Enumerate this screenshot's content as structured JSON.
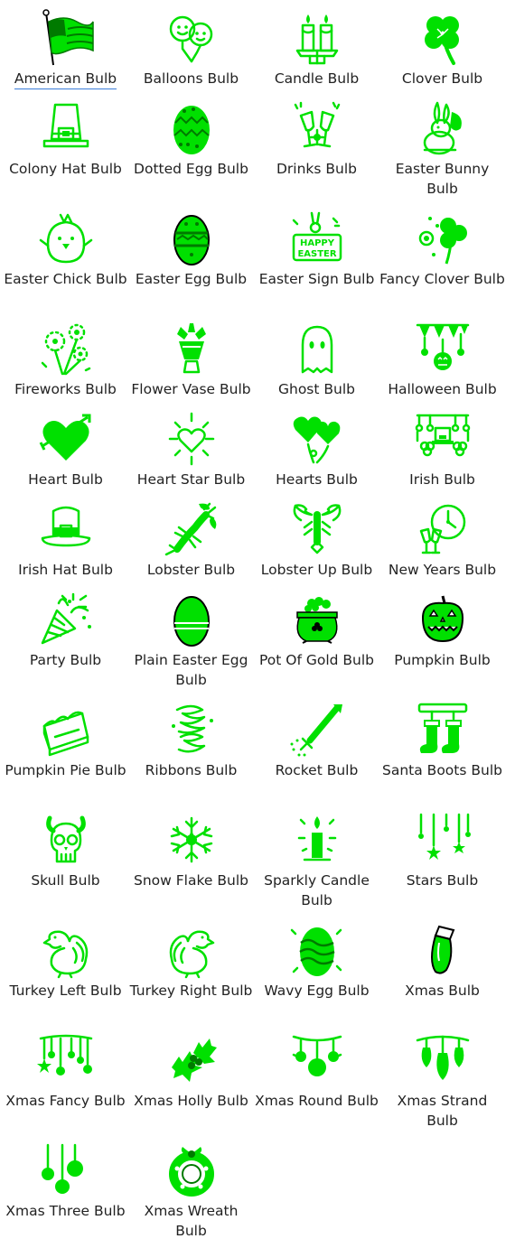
{
  "theme": {
    "icon_color": "#00e000",
    "icon_dark": "#007a00",
    "text_color": "#222222",
    "selected_underline": "#3b7dd8"
  },
  "selected_index": 0,
  "bulbs": [
    {
      "label": "American Bulb",
      "icon": "american-flag-icon"
    },
    {
      "label": "Balloons Bulb",
      "icon": "balloons-icon"
    },
    {
      "label": "Candle Bulb",
      "icon": "candle-icon"
    },
    {
      "label": "Clover Bulb",
      "icon": "clover-icon"
    },
    {
      "label": "Colony Hat Bulb",
      "icon": "colony-hat-icon"
    },
    {
      "label": "Dotted Egg Bulb",
      "icon": "dotted-egg-icon"
    },
    {
      "label": "Drinks Bulb",
      "icon": "drinks-icon"
    },
    {
      "label": "Easter Bunny Bulb",
      "icon": "easter-bunny-icon"
    },
    {
      "label": "Easter Chick Bulb",
      "icon": "easter-chick-icon"
    },
    {
      "label": "Easter Egg Bulb",
      "icon": "easter-egg-icon"
    },
    {
      "label": "Easter Sign Bulb",
      "icon": "easter-sign-icon",
      "sign_text": [
        "HAPPY",
        "EASTER"
      ]
    },
    {
      "label": "Fancy Clover Bulb",
      "icon": "fancy-clover-icon"
    },
    {
      "label": "Fireworks Bulb",
      "icon": "fireworks-icon"
    },
    {
      "label": "Flower Vase Bulb",
      "icon": "flower-vase-icon"
    },
    {
      "label": "Ghost Bulb",
      "icon": "ghost-icon"
    },
    {
      "label": "Halloween Bulb",
      "icon": "halloween-icon"
    },
    {
      "label": "Heart Bulb",
      "icon": "heart-arrow-icon"
    },
    {
      "label": "Heart Star Bulb",
      "icon": "heart-star-icon"
    },
    {
      "label": "Hearts Bulb",
      "icon": "hearts-icon"
    },
    {
      "label": "Irish Bulb",
      "icon": "irish-icon"
    },
    {
      "label": "Irish Hat Bulb",
      "icon": "irish-hat-icon"
    },
    {
      "label": "Lobster Bulb",
      "icon": "lobster-icon"
    },
    {
      "label": "Lobster Up Bulb",
      "icon": "lobster-up-icon"
    },
    {
      "label": "New Years Bulb",
      "icon": "new-years-icon"
    },
    {
      "label": "Party Bulb",
      "icon": "party-icon"
    },
    {
      "label": "Plain Easter Egg Bulb",
      "icon": "plain-easter-egg-icon"
    },
    {
      "label": "Pot Of Gold Bulb",
      "icon": "pot-of-gold-icon"
    },
    {
      "label": "Pumpkin Bulb",
      "icon": "pumpkin-icon"
    },
    {
      "label": "Pumpkin Pie Bulb",
      "icon": "pumpkin-pie-icon"
    },
    {
      "label": "Ribbons Bulb",
      "icon": "ribbons-icon"
    },
    {
      "label": "Rocket Bulb",
      "icon": "rocket-icon"
    },
    {
      "label": "Santa Boots Bulb",
      "icon": "santa-boots-icon"
    },
    {
      "label": "Skull Bulb",
      "icon": "skull-icon"
    },
    {
      "label": "Snow Flake Bulb",
      "icon": "snowflake-icon"
    },
    {
      "label": "Sparkly Candle Bulb",
      "icon": "sparkly-candle-icon"
    },
    {
      "label": "Stars Bulb",
      "icon": "stars-icon"
    },
    {
      "label": "Turkey Left Bulb",
      "icon": "turkey-left-icon"
    },
    {
      "label": "Turkey Right Bulb",
      "icon": "turkey-right-icon"
    },
    {
      "label": "Wavy Egg Bulb",
      "icon": "wavy-egg-icon"
    },
    {
      "label": "Xmas Bulb",
      "icon": "xmas-bulb-icon"
    },
    {
      "label": "Xmas Fancy Bulb",
      "icon": "xmas-fancy-icon"
    },
    {
      "label": "Xmas Holly Bulb",
      "icon": "xmas-holly-icon"
    },
    {
      "label": "Xmas Round Bulb",
      "icon": "xmas-round-icon"
    },
    {
      "label": "Xmas Strand Bulb",
      "icon": "xmas-strand-icon"
    },
    {
      "label": "Xmas Three Bulb",
      "icon": "xmas-three-icon"
    },
    {
      "label": "Xmas Wreath Bulb",
      "icon": "xmas-wreath-icon"
    }
  ]
}
